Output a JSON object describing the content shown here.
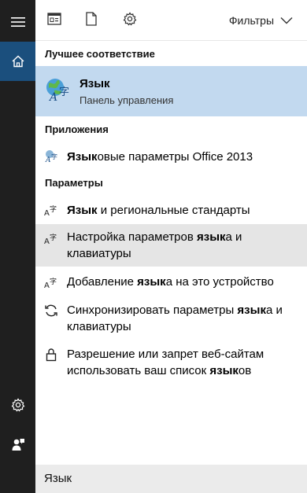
{
  "rail": {
    "icons": [
      "hamburger-icon",
      "home-icon",
      "gear-icon",
      "feedback-icon"
    ]
  },
  "toolbar": {
    "icons": [
      "apps-icon",
      "document-icon",
      "settings-icon"
    ],
    "filters_label": "Фильтры"
  },
  "best_match": {
    "header": "Лучшее соответствие",
    "title": "Язык",
    "subtitle": "Панель управления",
    "icon": "language-globe-icon"
  },
  "apps": {
    "header": "Приложения",
    "items": [
      {
        "bold": "Язык",
        "rest": "овые параметры Office 2013",
        "icon": "office-language-icon"
      }
    ]
  },
  "settings": {
    "header": "Параметры",
    "items": [
      {
        "line1_pre": "",
        "line1_bold": "Язык",
        "line1_post": " и региональные стандарты",
        "line2": "",
        "icon": "language-icon"
      },
      {
        "line1_pre": "Настройка параметров ",
        "line1_bold": "язык",
        "line1_post": "а и",
        "line2": "клавиатуры",
        "icon": "language-icon"
      },
      {
        "line1_pre": "Добавление ",
        "line1_bold": "язык",
        "line1_post": "а на это устройство",
        "line2": "",
        "icon": "language-icon"
      },
      {
        "line1_pre": "Синхронизировать параметры ",
        "line1_bold": "язык",
        "line1_post": "а и",
        "line2": "клавиатуры",
        "icon": "sync-icon"
      },
      {
        "line1_pre": "Разрешение или запрет веб-сайтам",
        "line1_bold": "",
        "line1_post": "",
        "line2_pre": "использовать ваш список ",
        "line2_bold": "язык",
        "line2_post": "ов",
        "icon": "lock-icon"
      }
    ]
  },
  "search": {
    "query": "Язык"
  }
}
